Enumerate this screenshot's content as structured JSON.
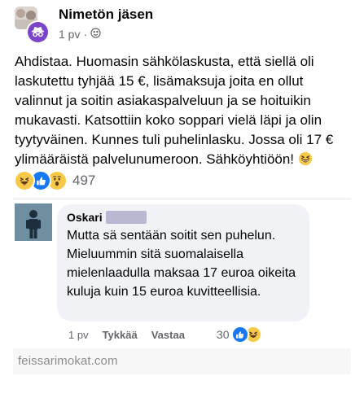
{
  "post": {
    "author_name": "Nimetön jäsen",
    "time": "1 pv",
    "separator": "·",
    "audience_icon": "globe-icon",
    "body": "Ahdistaa. Huomasin sähkölaskusta, että siellä oli laskutettu tyhjää 15 €, lisämaksuja joita en ollut valinnut ja soitin asiakaspalveluun ja se hoituikin mukavasti. Katsottiin koko soppari vielä läpi ja olin tyytyväinen. Kunnes tuli puhelinlasku. Jossa oli 17 € ylimääräistä palvelunumeroon. Sähköyhtiöön! ",
    "body_emoji": "grinning-squinting-face",
    "reactions": [
      "haha",
      "like",
      "wow"
    ],
    "reaction_count": "497"
  },
  "comment": {
    "author_name": "Oskari",
    "text": "Mutta sä sentään soitit sen puhelun. Mieluummin sitä suomalaisella mielenlaadulla maksaa 17 euroa oikeita kuluja kuin 15 euroa kuvitteellisia.",
    "time": "1 pv",
    "like_label": "Tykkää",
    "reply_label": "Vastaa",
    "reaction_count": "30",
    "reactions": [
      "like",
      "haha"
    ]
  },
  "watermark": "feissarimokat.com",
  "colors": {
    "anonymous_badge": "#7a45c8",
    "like_blue": "#1877f2",
    "emoji_yellow": "#f7c948",
    "bubble_bg": "#f0f2f5",
    "muted_text": "#65676b"
  }
}
